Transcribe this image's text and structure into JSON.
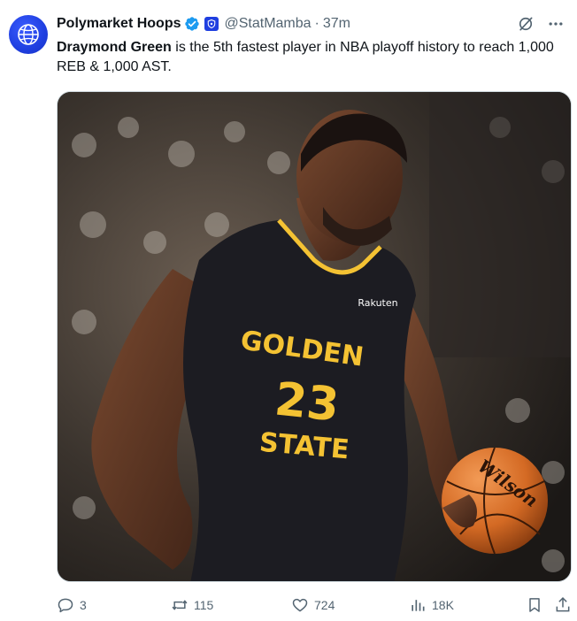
{
  "tweet": {
    "author_name": "Polymarket Hoops",
    "handle": "@StatMamba",
    "separator": "·",
    "time": "37m",
    "text_bold": "Draymond Green",
    "text_rest": " is the 5th fastest player in NBA playoff history to reach 1,000 REB & 1,000 AST.",
    "avatar_icon": "basketball-globe-icon",
    "verified_color": "#1d9bf0",
    "affiliate_color": "#1f3fe0"
  },
  "media": {
    "jersey_top": "GOLDEN",
    "jersey_number": "23",
    "jersey_bottom": "STATE",
    "sponsor": "Rakuten",
    "ball_brand": "Wilson",
    "jersey_color": "#1c1c22",
    "lettering_color": "#f4c233"
  },
  "actions": {
    "replies": "3",
    "reposts": "115",
    "likes": "724",
    "views": "18K",
    "color": "#536471"
  }
}
